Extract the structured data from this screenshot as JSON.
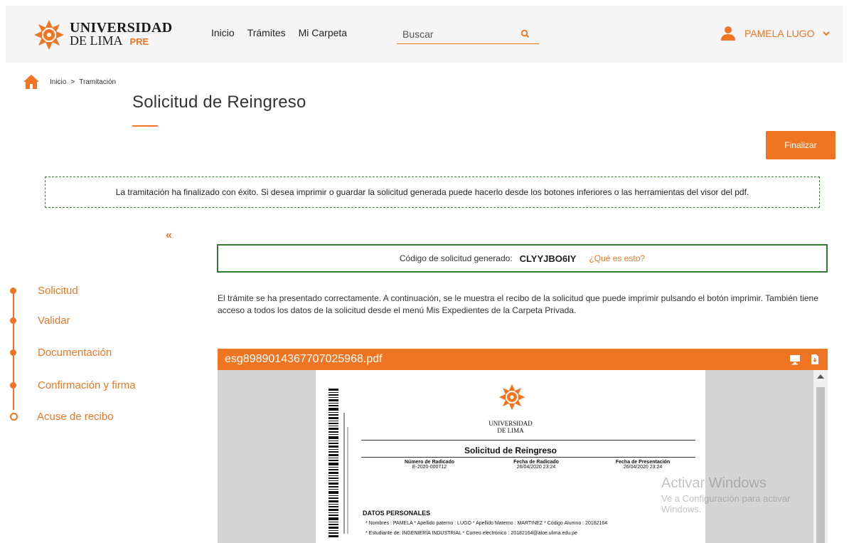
{
  "header": {
    "logo_line1": "UNIVERSIDAD",
    "logo_line2": "DE LIMA",
    "logo_tag": "PRE",
    "nav": [
      "Inicio",
      "Trámites",
      "Mi Carpeta"
    ],
    "search_placeholder": "Buscar",
    "user_name": "PAMELA LUGO"
  },
  "breadcrumb": {
    "home": "Inicio",
    "separator": ">",
    "current": "Tramitación"
  },
  "page_title": "Solicitud de Reingreso",
  "finalize_label": "Finalizar",
  "success_message": "La tramitación ha finalizado con éxito. Si desea imprimir o guardar la solicitud generada puede hacerlo desde los botones inferiores o las herramientas del visor del pdf.",
  "collapse_label": "«",
  "code": {
    "label": "Código de solicitud generado:",
    "value": "CLYYJBO6IY",
    "help": "¿Qué es esto?"
  },
  "steps": [
    {
      "label": "Solicitud"
    },
    {
      "label": "Validar"
    },
    {
      "label": "Documentación"
    },
    {
      "label": "Confirmación y firma"
    },
    {
      "label": "Acuse de recibo"
    }
  ],
  "description": "El trámite se ha presentado correctamente. A continuación, se le muestra el recibo de la solicitud que puede imprimir pulsando el botón imprimir. También tiene acceso a todos los datos de la solicitud desde el menú Mis Expedientes de la Carpeta Privada.",
  "pdf": {
    "filename": "esg8989014367707025968.pdf",
    "doc_uni_line1": "UNIVERSIDAD",
    "doc_uni_line2": "DE LIMA",
    "doc_title": "Solicitud de Reingreso",
    "col1_head": "Número de Radicado",
    "col1_val": "E-2020-000712",
    "col2_head": "Fecha de Radicado",
    "col2_val": "26/04/2020 23:24",
    "col3_head": "Fecha de Presentación",
    "col3_val": "26/04/2020 23:24",
    "section": "DATOS PERSONALES",
    "line1": "* Nombres : PAMELA   * Apellido paterno : LUGO   * Apellido Materno : MARTINEZ   * Código Alumno : 20182164",
    "line2": "* Estudiante de: INGENIERÍA INDUSTRIAL   * Correo electrónico : 20182164@aloe.ulima.edu.pe"
  },
  "watermark": {
    "line1": "Activar Windows",
    "line2": "Ve a Configuración para activar",
    "line3": "Windows."
  },
  "colors": {
    "accent": "#f07523",
    "success_border": "#2e7d32"
  }
}
